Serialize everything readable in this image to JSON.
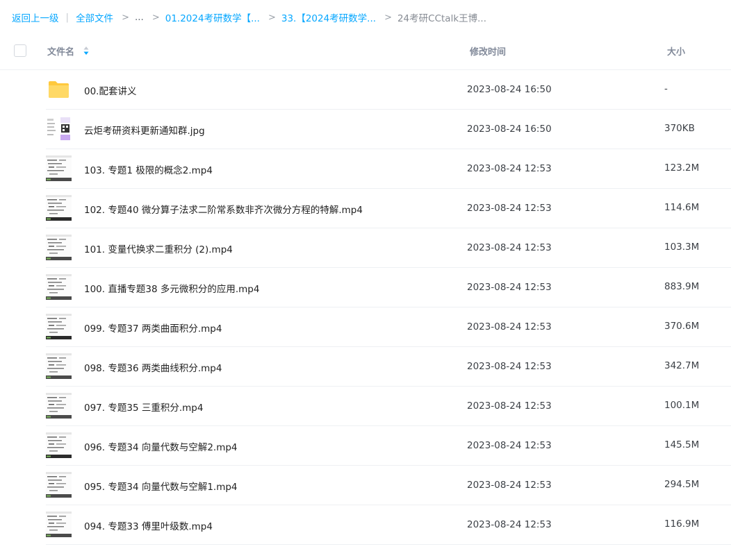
{
  "breadcrumb": {
    "back": "返回上一级",
    "all_files": "全部文件",
    "ellipsis": "...",
    "level1": "01.2024考研数学【...",
    "level2": "33.【2024考研数学...",
    "current": "24考研CCtalk王博..."
  },
  "header": {
    "name": "文件名",
    "time": "修改时间",
    "size": "大小"
  },
  "colors": {
    "accent": "#06a7ff",
    "folder": "#ffc93d"
  },
  "files": [
    {
      "name": "00.配套讲义",
      "time": "2023-08-24 16:50",
      "size": "-",
      "icon": "folder-icon"
    },
    {
      "name": "云炬考研资料更新通知群.jpg",
      "time": "2023-08-24 16:50",
      "size": "370KB",
      "icon": "image-thumbnail"
    },
    {
      "name": "103. 专题1 极限的概念2.mp4",
      "time": "2023-08-24 12:53",
      "size": "123.2M",
      "icon": "video-thumbnail"
    },
    {
      "name": "102. 专题40 微分算子法求二阶常系数非齐次微分方程的特解.mp4",
      "time": "2023-08-24 12:53",
      "size": "114.6M",
      "icon": "video-thumbnail"
    },
    {
      "name": "101. 变量代换求二重积分 (2).mp4",
      "time": "2023-08-24 12:53",
      "size": "103.3M",
      "icon": "video-thumbnail"
    },
    {
      "name": "100. 直播专题38 多元微积分的应用.mp4",
      "time": "2023-08-24 12:53",
      "size": "883.9M",
      "icon": "video-thumbnail"
    },
    {
      "name": "099. 专题37 两类曲面积分.mp4",
      "time": "2023-08-24 12:53",
      "size": "370.6M",
      "icon": "video-thumbnail"
    },
    {
      "name": "098. 专题36 两类曲线积分.mp4",
      "time": "2023-08-24 12:53",
      "size": "342.7M",
      "icon": "video-thumbnail"
    },
    {
      "name": "097. 专题35 三重积分.mp4",
      "time": "2023-08-24 12:53",
      "size": "100.1M",
      "icon": "video-thumbnail"
    },
    {
      "name": "096. 专题34 向量代数与空解2.mp4",
      "time": "2023-08-24 12:53",
      "size": "145.5M",
      "icon": "video-thumbnail"
    },
    {
      "name": "095. 专题34 向量代数与空解1.mp4",
      "time": "2023-08-24 12:53",
      "size": "294.5M",
      "icon": "video-thumbnail"
    },
    {
      "name": "094. 专题33 傅里叶级数.mp4",
      "time": "2023-08-24 12:53",
      "size": "116.9M",
      "icon": "video-thumbnail"
    }
  ]
}
